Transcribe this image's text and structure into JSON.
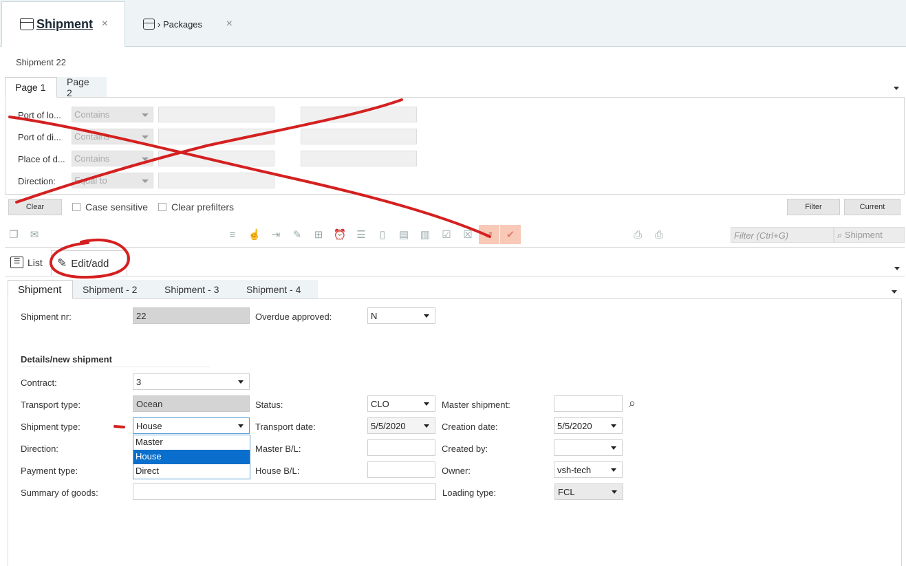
{
  "tabs": [
    {
      "label": "Shipment",
      "close": "×"
    },
    {
      "label": "› Packages",
      "close": "×"
    }
  ],
  "breadcrumb": "Shipment 22",
  "page_tabs": [
    "Page 1",
    "Page 2"
  ],
  "filters": [
    {
      "label": "Port of lo...",
      "op": "Contains"
    },
    {
      "label": "Port of di...",
      "op": "Contains"
    },
    {
      "label": "Place of d...",
      "op": "Contains"
    },
    {
      "label": "Direction:",
      "op": "Equal to"
    }
  ],
  "filter_bar": {
    "clear": "Clear",
    "case_sensitive": "Case sensitive",
    "clear_prefilters": "Clear prefilters",
    "filter": "Filter",
    "current": "Current"
  },
  "search": {
    "placeholder": "Filter (Ctrl+G)",
    "scope": "Shipment"
  },
  "view_tabs": {
    "list": "List",
    "edit": "Edit/add"
  },
  "form_tabs": [
    "Shipment",
    "Shipment - 2",
    "Shipment - 3",
    "Shipment - 4"
  ],
  "form": {
    "shipment_nr_label": "Shipment nr:",
    "shipment_nr": "22",
    "overdue_label": "Overdue approved:",
    "overdue": "N",
    "section": "Details/new shipment",
    "contract_label": "Contract:",
    "contract": "3",
    "transport_type_label": "Transport type:",
    "transport_type": "Ocean",
    "status_label": "Status:",
    "status": "CLO",
    "master_shipment_label": "Master shipment:",
    "shipment_type_label": "Shipment type:",
    "shipment_type": "House",
    "transport_date_label": "Transport date:",
    "transport_date": "5/5/2020",
    "creation_date_label": "Creation date:",
    "creation_date": "5/5/2020",
    "direction_label": "Direction:",
    "master_bl_label": "Master B/L:",
    "created_by_label": "Created by:",
    "payment_type_label": "Payment type:",
    "house_bl_label": "House B/L:",
    "owner_label": "Owner:",
    "owner": "vsh-tech",
    "summary_label": "Summary of goods:",
    "loading_type_label": "Loading type:",
    "loading_type": "FCL"
  },
  "shipment_type_options": [
    "Master",
    "House",
    "Direct"
  ],
  "annotation_color": "#d42020",
  "highlight_color": "#f9c9b8",
  "selection_color": "#0a6fcc"
}
